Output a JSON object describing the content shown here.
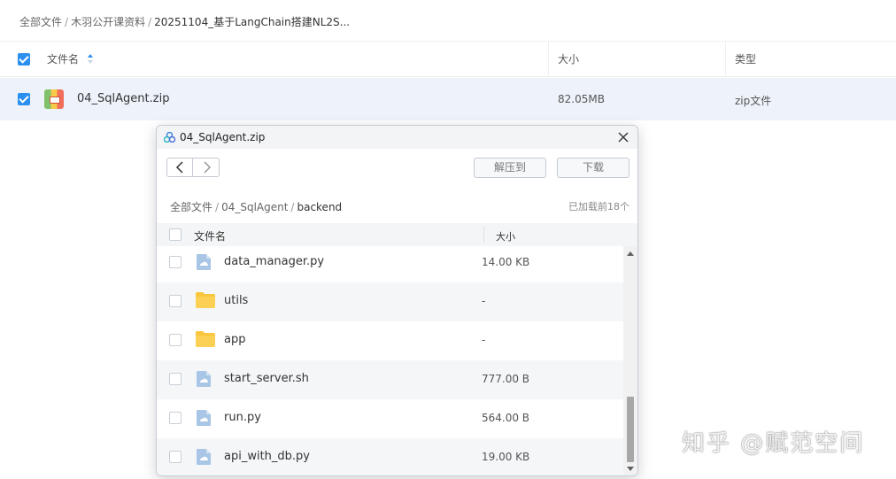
{
  "breadcrumb": {
    "items": [
      "全部文件",
      "木羽公开课资料"
    ],
    "separator": "/",
    "current": "20251104_基于LangChain搭建NL2S..."
  },
  "table": {
    "headers": {
      "name": "文件名",
      "size": "大小",
      "type": "类型"
    },
    "select_all_checked": true,
    "row": {
      "name": "04_SqlAgent.zip",
      "size": "82.05MB",
      "type": "zip文件",
      "checked": true
    }
  },
  "dialog": {
    "title": "04_SqlAgent.zip",
    "extract_label": "解压到",
    "download_label": "下载",
    "breadcrumb": {
      "items": [
        "全部文件",
        "04_SqlAgent"
      ],
      "separator": "/",
      "current": "backend"
    },
    "loaded_text": "已加载前18个",
    "headers": {
      "name": "文件名",
      "size": "大小"
    },
    "rows": [
      {
        "name": "data_manager.py",
        "size": "14.00 KB",
        "icon": "file-icon"
      },
      {
        "name": "utils",
        "size": "-",
        "icon": "folder-icon"
      },
      {
        "name": "app",
        "size": "-",
        "icon": "folder-icon"
      },
      {
        "name": "start_server.sh",
        "size": "777.00 B",
        "icon": "file-icon"
      },
      {
        "name": "run.py",
        "size": "564.00 B",
        "icon": "file-icon"
      },
      {
        "name": "api_with_db.py",
        "size": "19.00 KB",
        "icon": "file-icon"
      }
    ]
  },
  "watermark": "知乎 @赋范空间",
  "colors": {
    "accent": "#2b8ff0",
    "folder": "#f9c63d",
    "file": "#a9c6e6",
    "selected_row": "#eef3fb"
  }
}
